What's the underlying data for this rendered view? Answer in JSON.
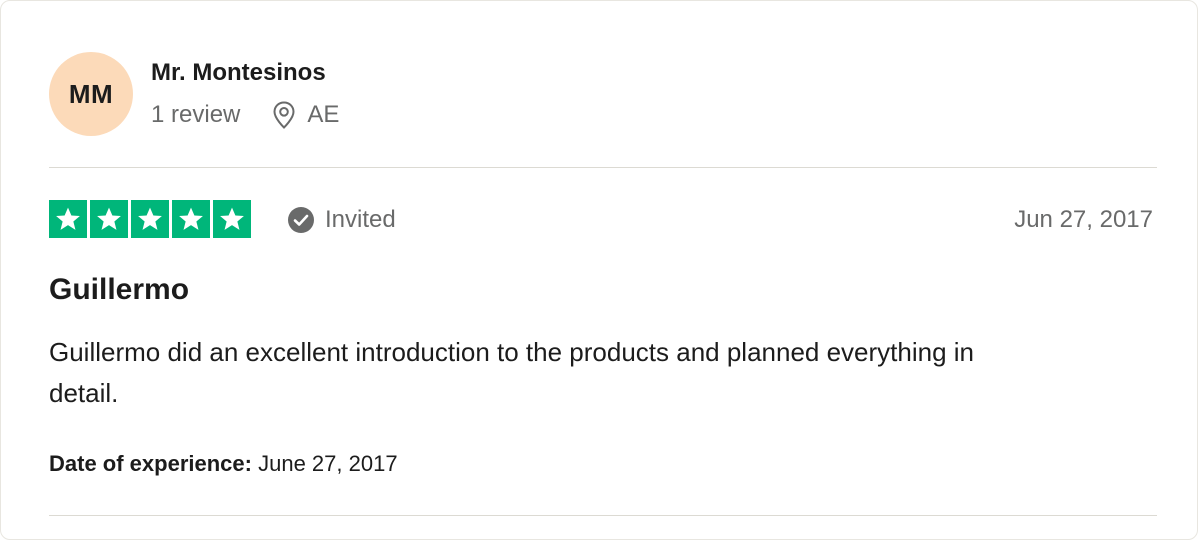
{
  "reviewer": {
    "initials": "MM",
    "name": "Mr. Montesinos",
    "review_count": "1 review",
    "location": "AE",
    "avatar_color": "#fcdab9"
  },
  "review": {
    "rating": 5,
    "rating_max": 5,
    "star_color": "#00b67a",
    "badge_label": "Invited",
    "badge_icon": "check-circle-icon",
    "date": "Jun 27, 2017",
    "title": "Guillermo",
    "body": "Guillermo did an excellent introduction to the products and planned everything in detail.",
    "experience_label": "Date of experience:",
    "experience_date": "June 27, 2017"
  }
}
